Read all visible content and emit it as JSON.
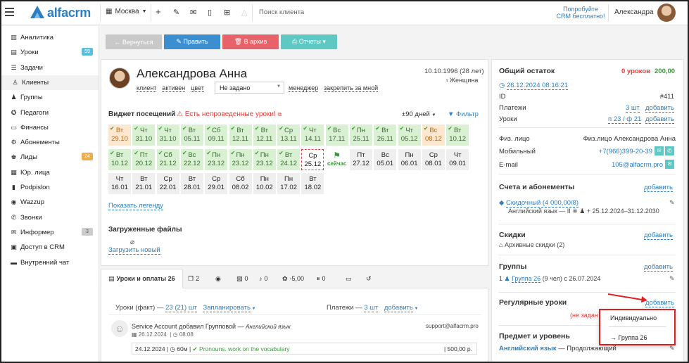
{
  "header": {
    "logo_text": "alfacrm",
    "city": "Москва",
    "search_placeholder": "Поиск клиента",
    "promo_line1": "Попробуйте",
    "promo_line2": "CRM бесплатно!",
    "user_name": "Александра"
  },
  "sidebar": {
    "items": [
      {
        "label": "Аналитика",
        "icon": "chart-icon"
      },
      {
        "label": "Уроки",
        "icon": "book-icon",
        "badge": "59",
        "badge_color": "#5bc0de"
      },
      {
        "label": "Задачи",
        "icon": "tasks-icon"
      },
      {
        "label": "Клиенты",
        "icon": "user-icon",
        "active": true
      },
      {
        "label": "Группы",
        "icon": "group-icon"
      },
      {
        "label": "Педагоги",
        "icon": "teacher-icon"
      },
      {
        "label": "Финансы",
        "icon": "money-icon"
      },
      {
        "label": "Абонементы",
        "icon": "gear-icon"
      },
      {
        "label": "Лиды",
        "icon": "leads-icon",
        "badge": "24",
        "badge_color": "#f0ad4e"
      },
      {
        "label": "Юр. лица",
        "icon": "building-icon"
      },
      {
        "label": "Podpislon",
        "icon": "document-icon"
      },
      {
        "label": "Wazzup",
        "icon": "chat-icon"
      },
      {
        "label": "Звонки",
        "icon": "phone-icon"
      },
      {
        "label": "Информер",
        "icon": "envelope-icon",
        "badge": "3",
        "badge_color": "#ccc"
      },
      {
        "label": "Доступ в CRM",
        "icon": "lock-icon"
      },
      {
        "label": "Внутренний чат",
        "icon": "chat-box-icon"
      }
    ]
  },
  "actions": {
    "back": "← Вернуться",
    "edit": "✎ Править",
    "archive": "🗑 В архив",
    "reports": "⎙ Отчеты ▾"
  },
  "client": {
    "name": "Александрова Анна",
    "birth": "10.10.1996 (28 лет)",
    "gender": "Женщина",
    "tags": [
      "клиент",
      "активен",
      "цвет"
    ],
    "status_select": "Не задано",
    "manager": "менеджер",
    "pin": "закрепить за мной"
  },
  "widget": {
    "title": "Виджет посещений",
    "warning": "Есть непроведенные уроки!",
    "period": "±90 дней",
    "filter": "Фильтр",
    "today_label": "сейчас",
    "legend_link": "Показать легенду",
    "tiles": [
      {
        "d": "Вт",
        "date": "29.10",
        "s": "o"
      },
      {
        "d": "Чт",
        "date": "31.10",
        "s": "g"
      },
      {
        "d": "Чт",
        "date": "31.10",
        "s": "g"
      },
      {
        "d": "Вт",
        "date": "05.11",
        "s": "g"
      },
      {
        "d": "Сб",
        "date": "09.11",
        "s": "g"
      },
      {
        "d": "Вт",
        "date": "12.11",
        "s": "g"
      },
      {
        "d": "Вт",
        "date": "12.11",
        "s": "g"
      },
      {
        "d": "Ср",
        "date": "13.11",
        "s": "g"
      },
      {
        "d": "Чт",
        "date": "14.11",
        "s": "g"
      },
      {
        "d": "Вс",
        "date": "17.11",
        "s": "g"
      },
      {
        "d": "Пн",
        "date": "25.11",
        "s": "g"
      },
      {
        "d": "Вт",
        "date": "26.11",
        "s": "g"
      },
      {
        "d": "Чт",
        "date": "05.12",
        "s": "g"
      },
      {
        "d": "Вс",
        "date": "08.12",
        "s": "o"
      },
      {
        "d": "Вт",
        "date": "10.12",
        "s": "g"
      },
      {
        "d": "Вт",
        "date": "10.12",
        "s": "g"
      },
      {
        "d": "Пт",
        "date": "20.12",
        "s": "g"
      },
      {
        "d": "Сб",
        "date": "21.12",
        "s": "g"
      },
      {
        "d": "Вс",
        "date": "22.12",
        "s": "g"
      },
      {
        "d": "Пн",
        "date": "23.12",
        "s": "g"
      },
      {
        "d": "Пн",
        "date": "23.12",
        "s": "g"
      },
      {
        "d": "Пн",
        "date": "23.12",
        "s": "g"
      },
      {
        "d": "Вт",
        "date": "24.12",
        "s": "g"
      },
      {
        "d": "Ср",
        "date": "25.12",
        "s": "cur"
      },
      {
        "d": "",
        "date": "",
        "s": "now"
      },
      {
        "d": "Пт",
        "date": "27.12",
        "s": "w"
      },
      {
        "d": "Вс",
        "date": "05.01",
        "s": "w"
      },
      {
        "d": "Пн",
        "date": "06.01",
        "s": "w"
      },
      {
        "d": "Ср",
        "date": "08.01",
        "s": "w"
      },
      {
        "d": "Чт",
        "date": "09.01",
        "s": "w"
      },
      {
        "d": "Чт",
        "date": "16.01",
        "s": "w"
      },
      {
        "d": "Вт",
        "date": "21.01",
        "s": "w"
      },
      {
        "d": "Ср",
        "date": "22.01",
        "s": "w"
      },
      {
        "d": "Вт",
        "date": "28.01",
        "s": "w"
      },
      {
        "d": "Ср",
        "date": "29.01",
        "s": "w"
      },
      {
        "d": "Сб",
        "date": "08.02",
        "s": "w"
      },
      {
        "d": "Пн",
        "date": "10.02",
        "s": "w"
      },
      {
        "d": "Пн",
        "date": "17.02",
        "s": "w"
      },
      {
        "d": "Вт",
        "date": "18.02",
        "s": "w"
      }
    ]
  },
  "files": {
    "title": "Загруженные файлы",
    "upload": "Загрузить новый"
  },
  "tabs": [
    {
      "label": "Уроки и оплаты 26",
      "icon": "book-icon"
    },
    {
      "label": "2",
      "icon": "copy-icon"
    },
    {
      "label": "",
      "icon": "whatsapp-icon"
    },
    {
      "label": "0",
      "icon": "note-icon"
    },
    {
      "label": "0",
      "icon": "music-icon"
    },
    {
      "label": "-5,00",
      "icon": "gift-icon"
    },
    {
      "label": "0",
      "icon": "pause-icon"
    },
    {
      "label": "",
      "icon": "card-icon"
    },
    {
      "label": "",
      "icon": "history-icon"
    }
  ],
  "lessons": {
    "fact_label": "Уроки (факт) —",
    "fact_value": "23 (21) шт",
    "planned": "Запланировать",
    "payments_label": "Платежи —",
    "payments_value": "3 шт",
    "add": "добавить",
    "entry_author": "Service Account",
    "entry_action": "добавил Групповой —",
    "entry_subject": "Английский язык",
    "entry_email": "support@alfacrm.pro",
    "entry_date": "26.12.2024",
    "entry_time": "08:08",
    "row_date": "24.12.2024",
    "row_duration": "60м",
    "row_topic": "Pronouns. work on the vocabulary",
    "row_amount": "500,00 р."
  },
  "right": {
    "balance_title": "Общий остаток",
    "balance_lessons": "0 уроков",
    "balance_money": "200,00",
    "created": "26.12.2024 08:16:21",
    "id_label": "ID",
    "id_value": "#411",
    "payments_label": "Платежи",
    "payments_value": "3 шт",
    "lessons_label": "Уроки",
    "lessons_value": "п 23 / ф 21",
    "add": "добавить",
    "person_label": "Физ. лицо",
    "person_value": "Физ.лицо Александрова Анна",
    "mobile_label": "Мобильный",
    "mobile_value": "+7(966)399-20-39",
    "email_label": "E-mail",
    "email_value": "105@alfacrm.pro",
    "accounts_title": "Счета и абонементы",
    "account_name": "Скидочный (4 000,00/8)",
    "account_detail": "Английский язык — II ※ ♟ +  25.12.2024–31.12.2030",
    "discounts_title": "Скидки",
    "discounts_archive": "Архивные скидки (2)",
    "groups_title": "Группы",
    "group_prefix": "1",
    "group_name": "Группа 26",
    "group_detail": "(9 чел) с 26.07.2024",
    "regular_title": "Регулярные уроки",
    "regular_none": "(не задан",
    "subject_title": "Предмет и уровень",
    "subject_value": "Английский язык",
    "subject_level": "— Продолжающий"
  },
  "popup": {
    "option1": "Индивидуально",
    "option2": "→ Группа 26"
  }
}
